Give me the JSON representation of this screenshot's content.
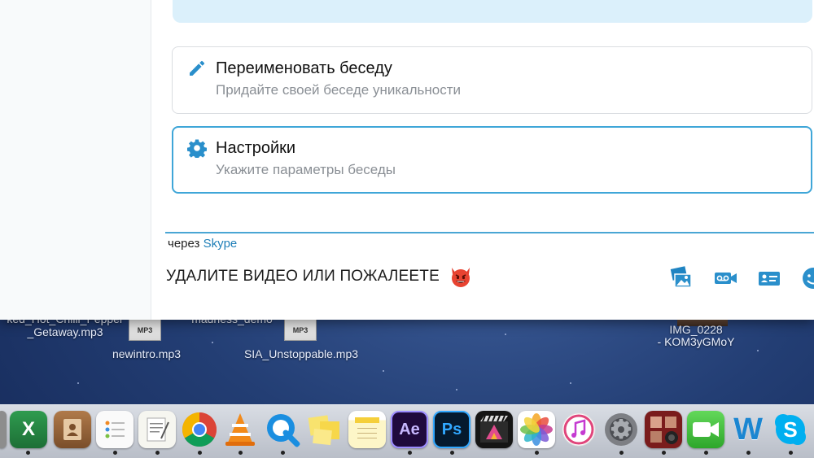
{
  "desktop": {
    "files": [
      {
        "label_line1": "ked_Hot_Chilli_Pepper",
        "label_line2": "_Getaway.mp3"
      },
      {
        "label_line1": "newintro.mp3"
      },
      {
        "label_line1": "madness_demo"
      },
      {
        "label_line1": "SIA_Unstoppable.mp3"
      },
      {
        "label_line1": "IMG_0228",
        "label_line2": "- KOM3yGMoY"
      }
    ],
    "mp3_badge": "MP3"
  },
  "skype": {
    "options": [
      {
        "title": "Переименовать беседу",
        "subtitle": "Придайте своей беседе уникальности",
        "icon": "pencil-icon"
      },
      {
        "title": "Настройки",
        "subtitle": "Укажите параметры беседы",
        "icon": "gear-icon"
      }
    ],
    "via_prefix": "через",
    "via_link": "Skype",
    "message": "УДАЛИТЕ ВИДЕО ИЛИ ПОЖАЛЕЕТЕ",
    "message_emoji": "devil-face-icon",
    "toolbar": [
      "send-image-icon",
      "video-message-icon",
      "send-contact-icon",
      "emoji-icon"
    ],
    "accent_color": "#3fa6d8"
  },
  "dock": {
    "apps": [
      "Excel",
      "Contacts",
      "Reminders",
      "TextEdit",
      "Chrome",
      "VLC",
      "QuickTime",
      "Stickies",
      "Notes",
      "Ae",
      "Ps",
      "Final Cut Pro",
      "Photos",
      "iTunes",
      "System Preferences",
      "Photo Booth",
      "FaceTime",
      "W",
      "Skype"
    ],
    "ae_label": "Ae",
    "ps_label": "Ps",
    "w_label": "W"
  }
}
